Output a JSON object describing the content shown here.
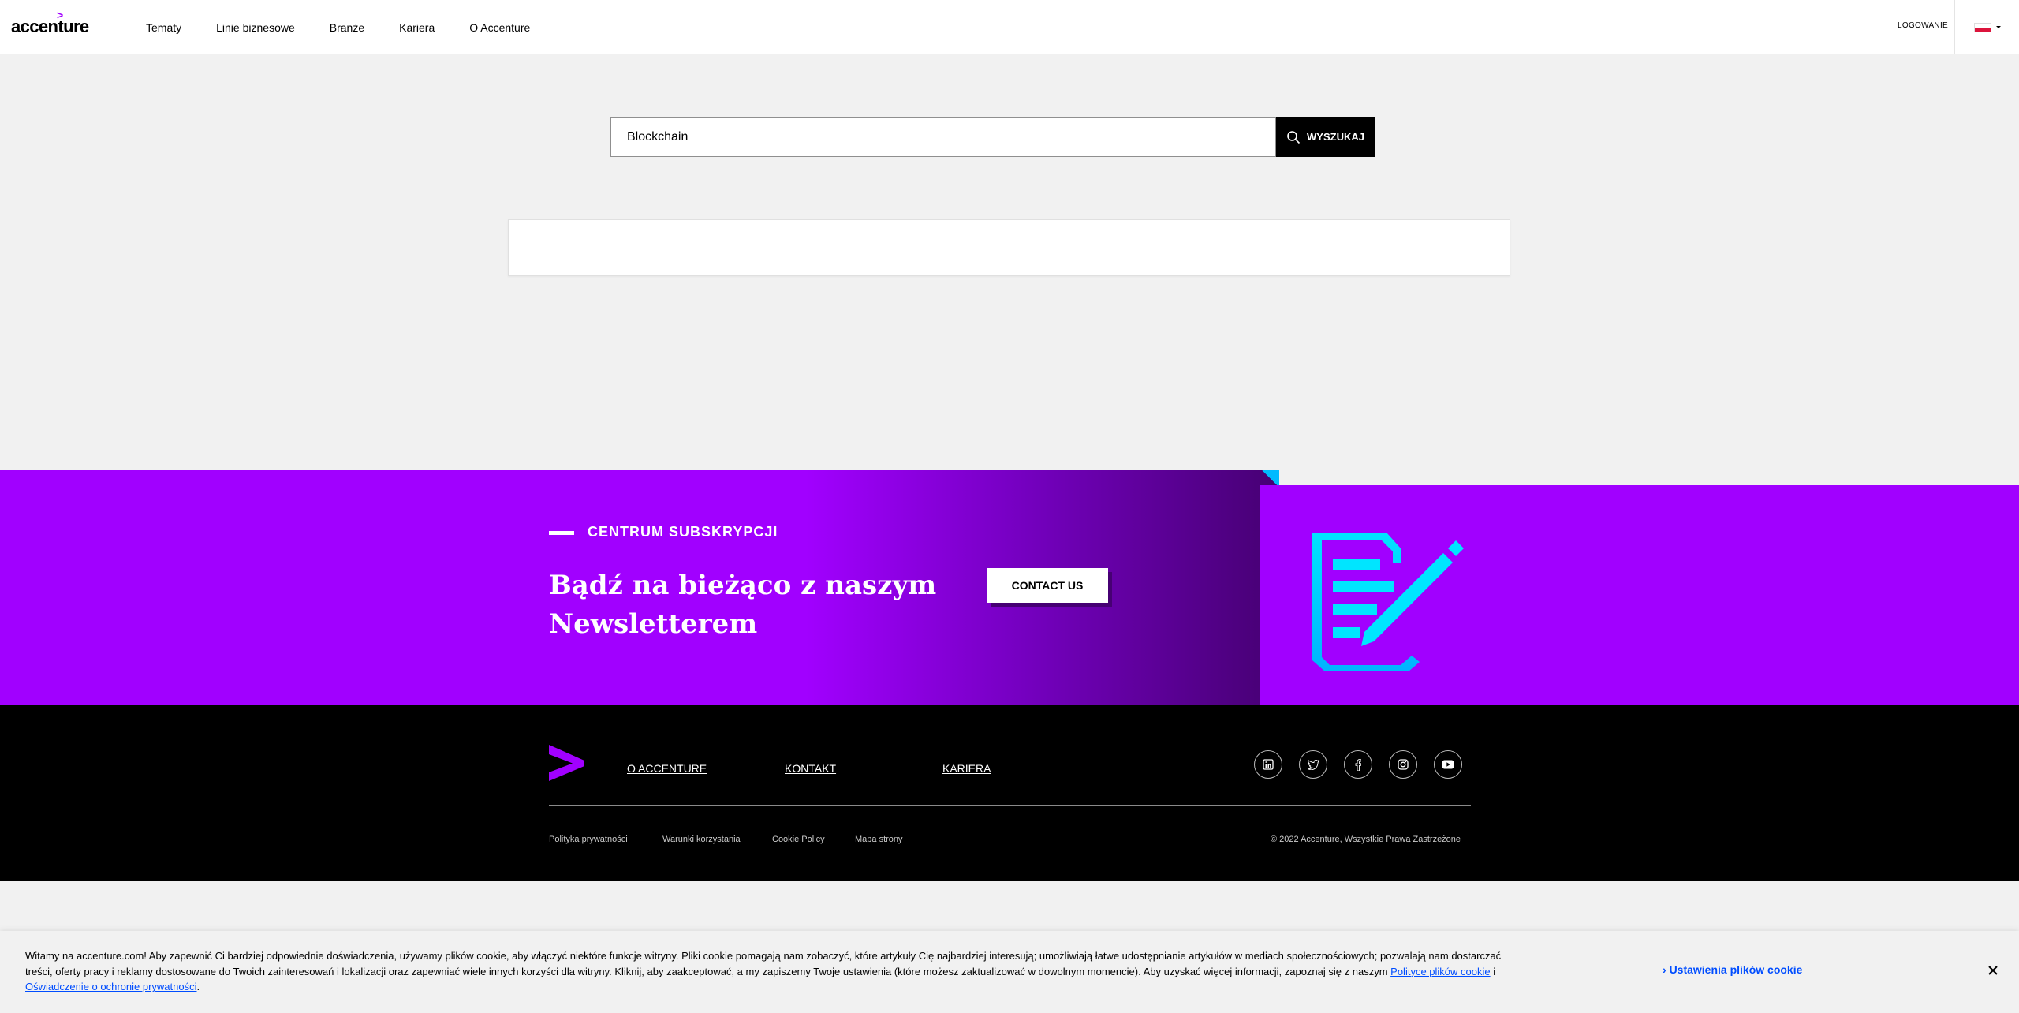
{
  "header": {
    "logo_text": "accenture",
    "nav": [
      "Tematy",
      "Linie biznesowe",
      "Branże",
      "Kariera",
      "O Accenture"
    ],
    "login_label": "LOGOWANIE",
    "language": "pl"
  },
  "search": {
    "value": "Blockchain",
    "button_label": "WYSZUKAJ"
  },
  "newsletter": {
    "eyebrow": "CENTRUM SUBSKRYPCJI",
    "headline": "Bądź na bieżąco z naszym Newsletterem",
    "cta_label": "CONTACT US",
    "colors": {
      "purple": "#a100ff",
      "dark_purple": "#460073",
      "icon": "#00e5ff"
    }
  },
  "footer": {
    "links": [
      "O ACCENTURE",
      "KONTAKT",
      "KARIERA"
    ],
    "social": [
      "linkedin-icon",
      "twitter-icon",
      "facebook-icon",
      "instagram-icon",
      "youtube-icon"
    ],
    "legal_links": [
      " Polityka prywatności",
      "Warunki korzystania",
      "Cookie Policy",
      "Mapa strony"
    ],
    "copyright": "© 2022 Accenture, Wszystkie Prawa Zastrzeżone"
  },
  "cookie": {
    "text": "Witamy na accenture.com! Aby zapewnić Ci bardziej odpowiednie doświadczenia, używamy plików cookie, aby włączyć niektóre funkcje witryny. Pliki cookie pomagają nam zobaczyć, które artykuły Cię najbardziej interesują; umożliwiają łatwe udostępnianie artykułów w mediach społecznościowych; pozwalają nam dostarczać treści, oferty pracy i reklamy dostosowane do Twoich zainteresowań i lokalizacji oraz zapewniać wiele innych korzyści dla witryny. Kliknij, aby zaakceptować, a my zapiszemy Twoje ustawienia (które możesz zaktualizować w dowolnym momencie). Aby uzyskać więcej informacji, zapoznaj się z naszym",
    "policy_link": "Polityce plików cookie",
    "joiner": "i",
    "privacy_link": "Oświadczenie o ochronie prywatności",
    "end": ".",
    "settings_label": "Ustawienia plików cookie"
  }
}
